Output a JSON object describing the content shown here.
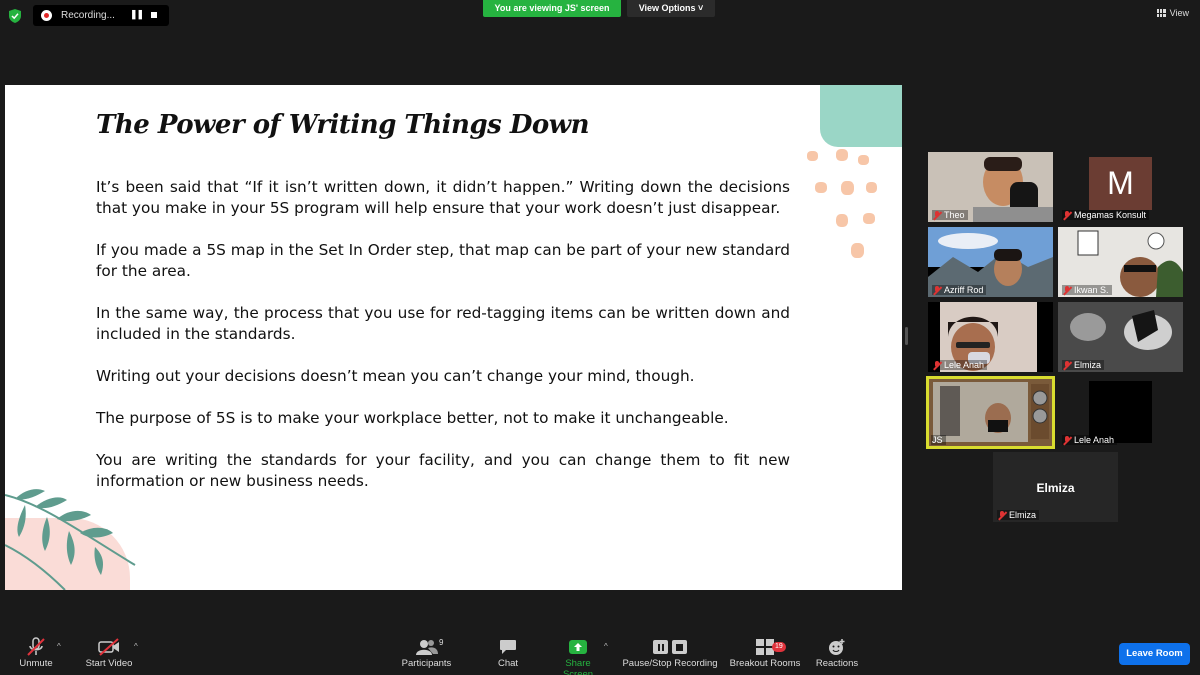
{
  "top_bar": {
    "recording_label": "Recording...",
    "viewing_banner": "You are viewing JS' screen",
    "view_options_label": "View Options ˅",
    "view_label": "View"
  },
  "slide": {
    "title": "The Power of Writing Things Down",
    "paragraphs": [
      "It’s been said that “If it isn’t written down, it didn’t happen.” Writing down the decisions that you make in your 5S program will help ensure that your work doesn’t just disappear.",
      "If you made a 5S map in the Set In Order step, that map can be part of your new standard for the area.",
      "In the same way, the process that you use for red-tagging items can be written down and included in the standards.",
      "Writing out your decisions doesn’t mean you can’t change your mind, though.",
      "The purpose of 5S is to make your workplace better, not to make it unchangeable.",
      "You are writing the standards for your facility, and you can change them to fit new information or new business needs."
    ]
  },
  "participants": [
    {
      "name": "Theo"
    },
    {
      "name": "Megamas Konsult",
      "avatar_letter": "M"
    },
    {
      "name": "Azriff Rod"
    },
    {
      "name": "Ikwan S."
    },
    {
      "name": "Lele Anah"
    },
    {
      "name": "Elmiza"
    },
    {
      "name": "JS"
    },
    {
      "name": "Lele Anah"
    },
    {
      "name": "Elmiza",
      "display_name": "Elmiza"
    }
  ],
  "toolbar": {
    "unmute": "Unmute",
    "start_video": "Start Video",
    "participants": "Participants",
    "participants_count": "9",
    "chat": "Chat",
    "share_screen": "Share Screen",
    "pause_stop_recording": "Pause/Stop Recording",
    "breakout_rooms": "Breakout Rooms",
    "breakout_count": "19",
    "reactions": "Reactions",
    "leave_room": "Leave Room"
  },
  "colors": {
    "share_green": "#26b340",
    "leave_blue": "#0e71eb",
    "active_speaker": "#d9dc2f",
    "muted_red": "#e0333c"
  }
}
